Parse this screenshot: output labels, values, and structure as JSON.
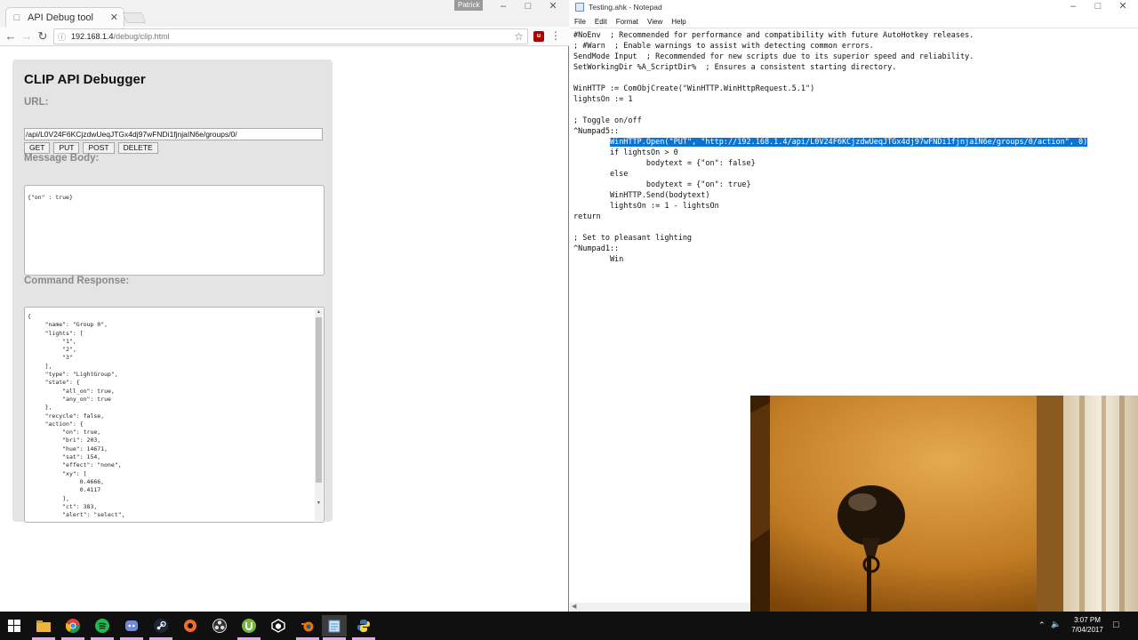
{
  "chrome": {
    "tab_title": "API Debug tool",
    "profile_name": "Patrick",
    "url_host": "192.168.1.4",
    "url_path": "/debug/clip.html"
  },
  "page": {
    "heading": "CLIP API Debugger",
    "url_label": "URL:",
    "url_value": "/api/L0V24F6KCjzdwUeqJTGx4dj97wFNDi1fjnjaIN6e/groups/0/",
    "buttons": [
      "GET",
      "PUT",
      "POST",
      "DELETE"
    ],
    "message_body_label": "Message Body:",
    "message_body": "{\"on\" : true}",
    "command_response_label": "Command Response:",
    "command_response": "{\n\t\"name\": \"Group 0\",\n\t\"lights\": [\n\t\t\"1\",\n\t\t\"2\",\n\t\t\"3\"\n\t],\n\t\"type\": \"LightGroup\",\n\t\"state\": {\n\t\t\"all_on\": true,\n\t\t\"any_on\": true\n\t},\n\t\"recycle\": false,\n\t\"action\": {\n\t\t\"on\": true,\n\t\t\"bri\": 203,\n\t\t\"hue\": 14671,\n\t\t\"sat\": 154,\n\t\t\"effect\": \"none\",\n\t\t\"xy\": [\n\t\t\t0.4666,\n\t\t\t0.4117\n\t\t],\n\t\t\"ct\": 383,\n\t\t\"alert\": \"select\","
  },
  "notepad": {
    "title": "Testing.ahk - Notepad",
    "menu": [
      "File",
      "Edit",
      "Format",
      "View",
      "Help"
    ],
    "lines": [
      "#NoEnv  ; Recommended for performance and compatibility with future AutoHotkey releases.",
      "; #Warn  ; Enable warnings to assist with detecting common errors.",
      "SendMode Input  ; Recommended for new scripts due to its superior speed and reliability.",
      "SetWorkingDir %A_ScriptDir%  ; Ensures a consistent starting directory.",
      "",
      "WinHTTP := ComObjCreate(\"WinHTTP.WinHttpRequest.5.1\")",
      "lightsOn := 1",
      "",
      "; Toggle on/off",
      "^Numpad5::",
      "        WinHTTP.Open(\"PUT\", \"http://192.168.1.4/api/L0V24F6KCjzdwUeqJTGx4dj97wFNDi1fjnjaIN6e/groups/0/action\", 0)",
      "        if lightsOn > 0",
      "                bodytext = {\"on\": false}",
      "        else",
      "                bodytext = {\"on\": true}",
      "        WinHTTP.Send(bodytext)",
      "        lightsOn := 1 - lightsOn",
      "return",
      "",
      "; Set to pleasant lighting",
      "^Numpad1::",
      "        Win"
    ],
    "selected_line_index": 10
  },
  "taskbar": {
    "time": "3:07 PM",
    "date": "7/04/2017",
    "apps": [
      "windows-start",
      "file-explorer",
      "chrome",
      "spotify",
      "discord",
      "steam",
      "origin",
      "obs",
      "utorrent",
      "unity",
      "blender",
      "notepad",
      "python"
    ]
  }
}
